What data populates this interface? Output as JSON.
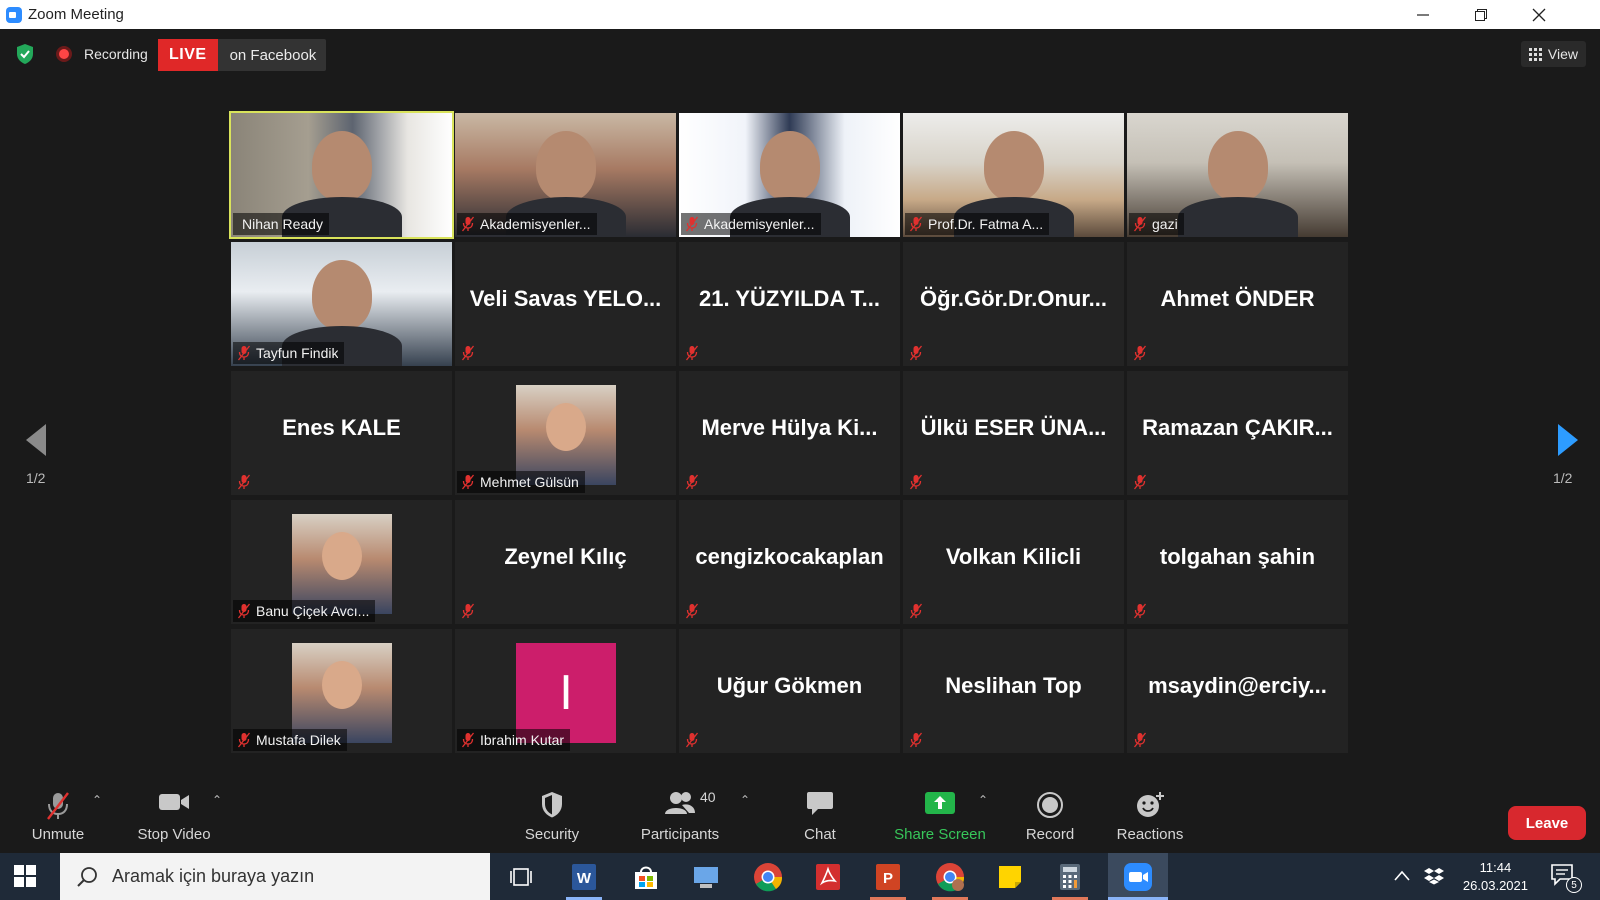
{
  "window": {
    "title": "Zoom Meeting"
  },
  "status": {
    "recording_label": "Recording",
    "live_badge": "LIVE",
    "live_target": "on Facebook",
    "view_label": "View"
  },
  "gallery": {
    "page_indicator": "1/2",
    "participants": [
      {
        "name": "Nihan Ready",
        "kind": "video",
        "active": true,
        "muted": false
      },
      {
        "name": "Akademisyenler...",
        "kind": "video",
        "muted": true
      },
      {
        "name": "Akademisyenler...",
        "kind": "video",
        "muted": true
      },
      {
        "name": "Prof.Dr. Fatma A...",
        "kind": "video",
        "muted": true
      },
      {
        "name": "gazi",
        "kind": "video",
        "muted": true
      },
      {
        "name": "Tayfun Findik",
        "kind": "video",
        "muted": true
      },
      {
        "name": "Veli Savas YELO...",
        "kind": "name",
        "muted": true
      },
      {
        "name": "21. YÜZYILDA T...",
        "kind": "name",
        "muted": true
      },
      {
        "name": "Öğr.Gör.Dr.Onur...",
        "kind": "name",
        "muted": true
      },
      {
        "name": "Ahmet ÖNDER",
        "kind": "name",
        "muted": true
      },
      {
        "name": "Enes KALE",
        "kind": "name",
        "muted": true
      },
      {
        "name": "Mehmet Gülsün",
        "kind": "avatar",
        "muted": true
      },
      {
        "name": "Merve Hülya Ki...",
        "kind": "name",
        "muted": true
      },
      {
        "name": "Ülkü ESER ÜNA...",
        "kind": "name",
        "muted": true
      },
      {
        "name": "Ramazan ÇAKIR...",
        "kind": "name",
        "muted": true
      },
      {
        "name": "Banu Çiçek Avcı...",
        "kind": "avatar",
        "muted": true
      },
      {
        "name": "Zeynel Kılıç",
        "kind": "name",
        "muted": true
      },
      {
        "name": "cengizkocakaplan",
        "kind": "name",
        "muted": true
      },
      {
        "name": "Volkan Kilicli",
        "kind": "name",
        "muted": true
      },
      {
        "name": "tolgahan şahin",
        "kind": "name",
        "muted": true
      },
      {
        "name": "Mustafa Dilek",
        "kind": "avatar",
        "muted": true
      },
      {
        "name": "Ibrahim Kutar",
        "kind": "letter",
        "letter": "I",
        "muted": true
      },
      {
        "name": "Uğur Gökmen",
        "kind": "name",
        "muted": true
      },
      {
        "name": "Neslihan Top",
        "kind": "name",
        "muted": true
      },
      {
        "name": "msaydin@erciy...",
        "kind": "name",
        "muted": true
      }
    ]
  },
  "toolbar": {
    "unmute": "Unmute",
    "stop_video": "Stop Video",
    "security": "Security",
    "participants": "Participants",
    "participants_count": "40",
    "chat": "Chat",
    "share_screen": "Share Screen",
    "record": "Record",
    "reactions": "Reactions",
    "leave": "Leave"
  },
  "taskbar": {
    "search_placeholder": "Aramak için buraya yazın",
    "time": "11:44",
    "date": "26.03.2021",
    "notification_count": "5"
  },
  "colors": {
    "accent_blue": "#2d8cff",
    "live_red": "#e02828",
    "active_speaker": "#d9e35b",
    "share_green": "#37c65a",
    "leave_red": "#d8282e"
  }
}
